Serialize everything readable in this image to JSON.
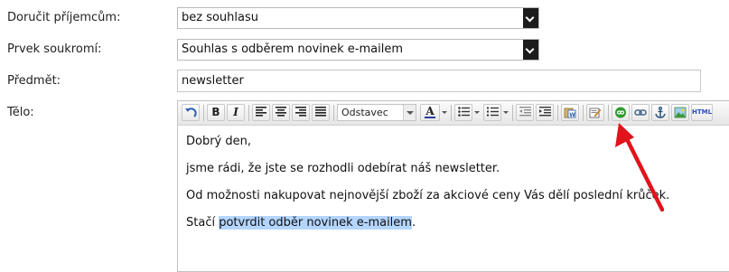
{
  "form": {
    "recipients": {
      "label": "Doručit příjemcům:",
      "value": "bez souhlasu"
    },
    "privacy": {
      "label": "Prvek soukromí:",
      "value": "Souhlas s odběrem novinek e-mailem"
    },
    "subject": {
      "label": "Předmět:",
      "value": "newsletter"
    },
    "body": {
      "label": "Tělo:"
    }
  },
  "toolbar": {
    "bold": "B",
    "italic": "I",
    "format_select": "Odstavec",
    "font_color_letter": "A",
    "html_button": "HTML"
  },
  "editor": {
    "line1": "Dobrý den,",
    "line2": "jsme rádi, že jste se rozhodli odebírat náš newsletter.",
    "line3": "Od možnosti nakupovat nejnovější zboží za akciové ceny Vás dělí poslední krůček.",
    "line4_prefix": "Stačí ",
    "line4_selected": "potvrdit odběr novinek e-mailem",
    "line4_suffix": "."
  },
  "colors": {
    "accent_highlight": "#b4d5fe",
    "annotation_arrow": "#e0141b",
    "green_button": "#2e9b2e"
  }
}
